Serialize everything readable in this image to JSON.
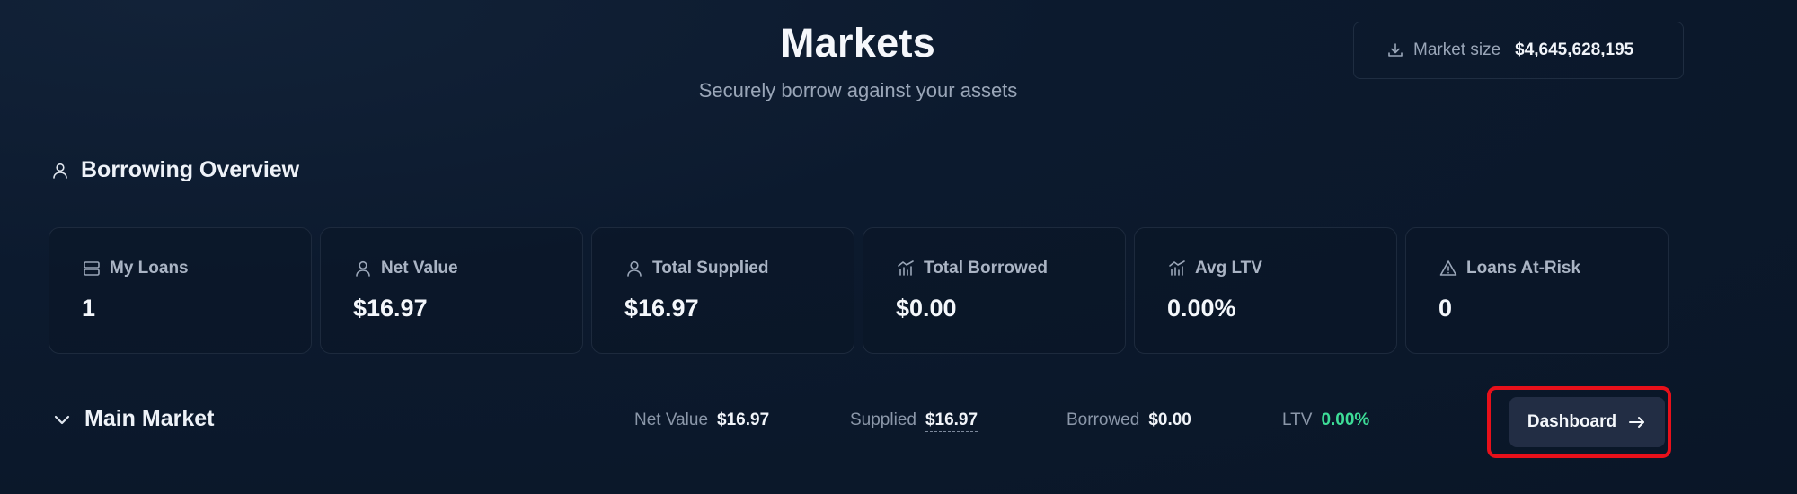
{
  "header": {
    "title": "Markets",
    "subtitle": "Securely borrow against your assets"
  },
  "market_size": {
    "icon": "download-icon",
    "label": "Market size",
    "value": "$4,645,628,195"
  },
  "overview": {
    "icon": "user-icon",
    "title": "Borrowing Overview",
    "cards": [
      {
        "icon": "stack-icon",
        "label": "My Loans",
        "value": "1"
      },
      {
        "icon": "user-icon",
        "label": "Net Value",
        "value": "$16.97"
      },
      {
        "icon": "user-icon",
        "label": "Total Supplied",
        "value": "$16.97"
      },
      {
        "icon": "chart-icon",
        "label": "Total Borrowed",
        "value": "$0.00"
      },
      {
        "icon": "chart-icon",
        "label": "Avg LTV",
        "value": "0.00%"
      },
      {
        "icon": "warning-icon",
        "label": "Loans At-Risk",
        "value": "0"
      }
    ]
  },
  "main_market": {
    "title": "Main Market",
    "net_value_label": "Net Value",
    "net_value": "$16.97",
    "supplied_label": "Supplied",
    "supplied": "$16.97",
    "borrowed_label": "Borrowed",
    "borrowed": "$0.00",
    "ltv_label": "LTV",
    "ltv": "0.00%",
    "ltv_color": "#3ddc97",
    "dashboard_button": "Dashboard",
    "highlight_color": "#e8101a"
  }
}
